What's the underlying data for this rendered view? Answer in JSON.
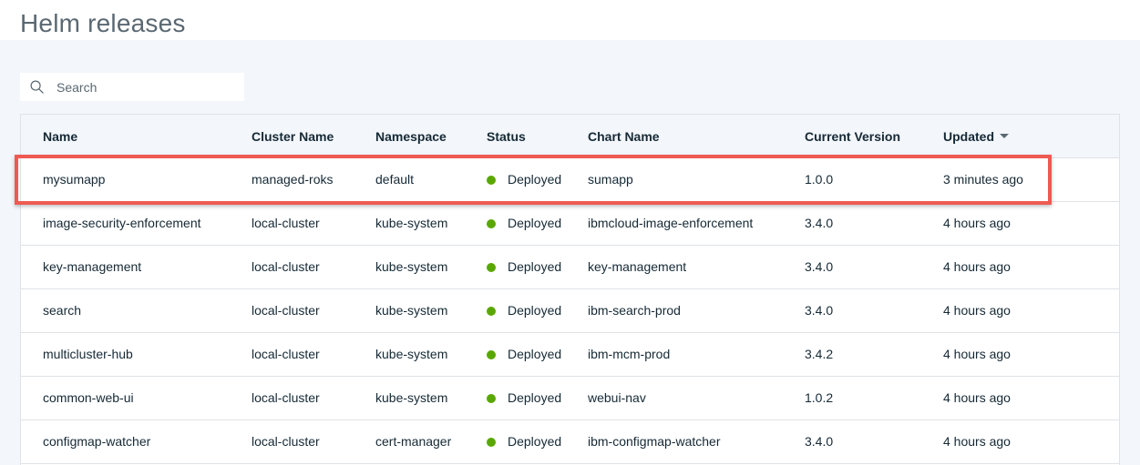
{
  "page": {
    "title": "Helm releases"
  },
  "search": {
    "placeholder": "Search",
    "icon": "search-icon"
  },
  "table": {
    "columns": [
      "Name",
      "Cluster Name",
      "Namespace",
      "Status",
      "Chart Name",
      "Current Version",
      "Updated"
    ],
    "sorted_column": "Updated",
    "sort_direction": "descending",
    "status_color": "#5aa700",
    "rows": [
      {
        "name": "mysumapp",
        "cluster": "managed-roks",
        "namespace": "default",
        "status": "Deployed",
        "chart": "sumapp",
        "version": "1.0.0",
        "updated": "3 minutes ago",
        "highlighted": true
      },
      {
        "name": "image-security-enforcement",
        "cluster": "local-cluster",
        "namespace": "kube-system",
        "status": "Deployed",
        "chart": "ibmcloud-image-enforcement",
        "version": "3.4.0",
        "updated": "4 hours ago"
      },
      {
        "name": "key-management",
        "cluster": "local-cluster",
        "namespace": "kube-system",
        "status": "Deployed",
        "chart": "key-management",
        "version": "3.4.0",
        "updated": "4 hours ago"
      },
      {
        "name": "search",
        "cluster": "local-cluster",
        "namespace": "kube-system",
        "status": "Deployed",
        "chart": "ibm-search-prod",
        "version": "3.4.0",
        "updated": "4 hours ago"
      },
      {
        "name": "multicluster-hub",
        "cluster": "local-cluster",
        "namespace": "kube-system",
        "status": "Deployed",
        "chart": "ibm-mcm-prod",
        "version": "3.4.2",
        "updated": "4 hours ago"
      },
      {
        "name": "common-web-ui",
        "cluster": "local-cluster",
        "namespace": "kube-system",
        "status": "Deployed",
        "chart": "webui-nav",
        "version": "1.0.2",
        "updated": "4 hours ago"
      },
      {
        "name": "configmap-watcher",
        "cluster": "local-cluster",
        "namespace": "cert-manager",
        "status": "Deployed",
        "chart": "ibm-configmap-watcher",
        "version": "3.4.0",
        "updated": "4 hours ago"
      }
    ]
  },
  "highlight_color": "#ee5a52"
}
